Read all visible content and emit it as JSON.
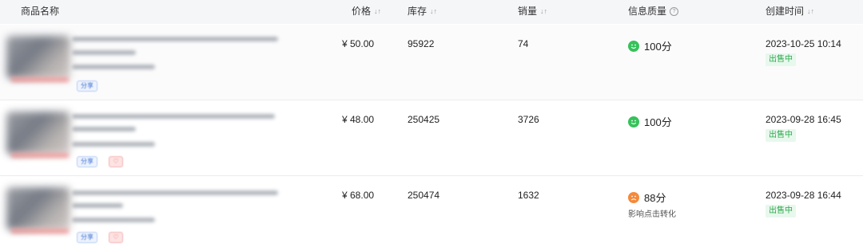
{
  "header": {
    "product_name": "商品名称",
    "price": "价格",
    "stock": "库存",
    "sales": "销量",
    "quality": "信息质量",
    "created": "创建时间"
  },
  "rows": [
    {
      "share": "分享",
      "price": "¥ 50.00",
      "stock": "95922",
      "sales": "74",
      "quality_icon": "smile-icon",
      "quality": "100分",
      "quality_hint": "",
      "created": "2023-10-25 10:14",
      "status": "出售中"
    },
    {
      "share": "分享",
      "price": "¥ 48.00",
      "stock": "250425",
      "sales": "3726",
      "quality_icon": "smile-icon",
      "quality": "100分",
      "quality_hint": "",
      "created": "2023-09-28 16:45",
      "status": "出售中"
    },
    {
      "share": "分享",
      "price": "¥ 68.00",
      "stock": "250474",
      "sales": "1632",
      "quality_icon": "frown-icon",
      "quality": "88分",
      "quality_hint": "影响点击转化",
      "created": "2023-09-28 16:44",
      "status": "出售中"
    }
  ],
  "colors": {
    "good": "#35c25a",
    "warning": "#f5893a",
    "status_text": "#2fa84f",
    "status_bg": "#e7f8ec",
    "share_text": "#3b6fd6",
    "header_bg": "#f5f6f8"
  }
}
